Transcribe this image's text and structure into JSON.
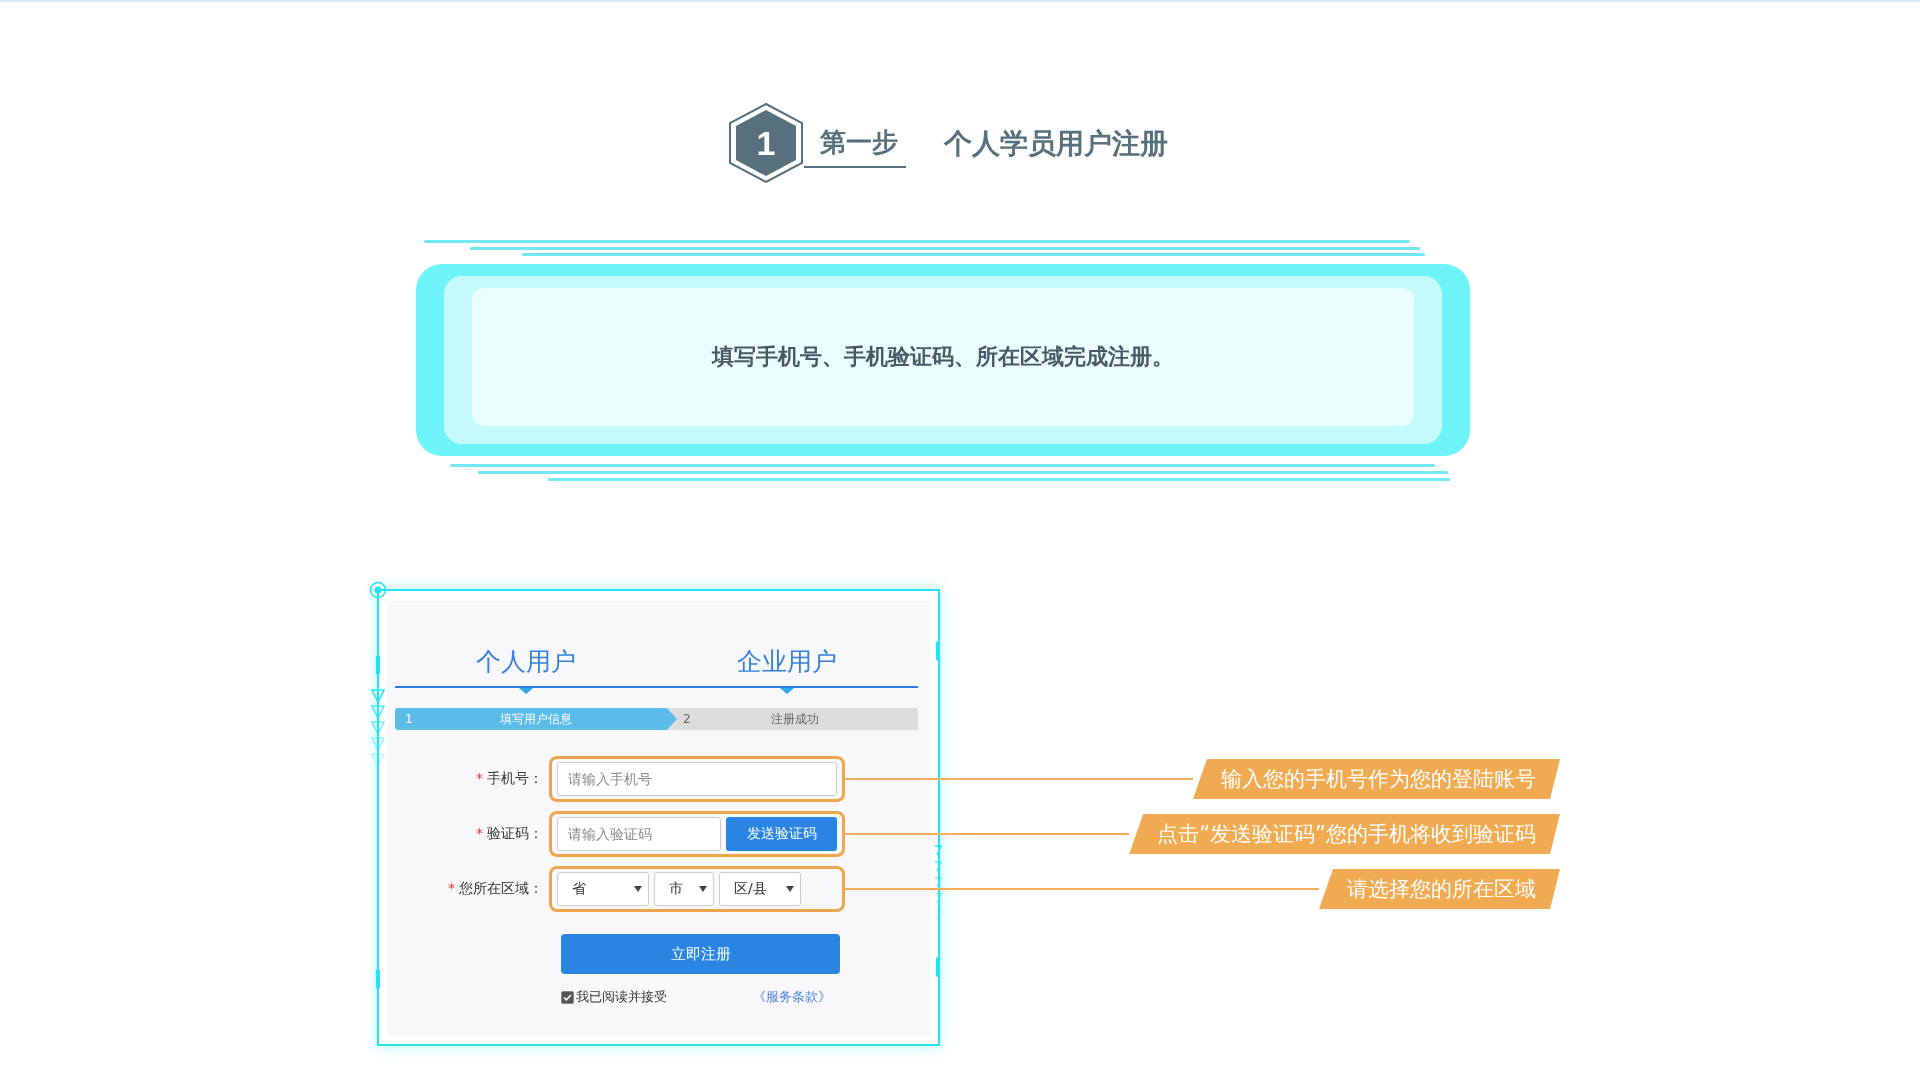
{
  "header": {
    "step_number": "1",
    "step_label": "第一步",
    "title": "个人学员用户注册"
  },
  "banner": {
    "text": "填写手机号、手机验证码、所在区域完成注册。"
  },
  "form": {
    "tabs": [
      {
        "label": "个人用户"
      },
      {
        "label": "企业用户"
      }
    ],
    "steps": [
      {
        "number": "1",
        "label": "填写用户信息",
        "selected": true
      },
      {
        "number": "2",
        "label": "注册成功",
        "selected": false
      }
    ],
    "fields": [
      {
        "kind": "text",
        "marker": "*",
        "label": "手机号：",
        "placeholder": "请输入手机号",
        "callout": "输入您的手机号作为您的登陆账号"
      },
      {
        "kind": "code",
        "marker": "*",
        "label": "验证码：",
        "placeholder": "请输入验证码",
        "button": "发送验证码",
        "callout": "点击“发送验证码”您的手机将收到验证码"
      },
      {
        "kind": "selects",
        "marker": "*",
        "label": "您所在区域：",
        "selects": [
          "省",
          "市",
          "区/县"
        ],
        "callout": "请选择您的所在区域"
      }
    ],
    "submit": "立即注册",
    "agreement": {
      "checked": true,
      "text": "我已阅读并接受",
      "link": "《服务条款》"
    }
  }
}
